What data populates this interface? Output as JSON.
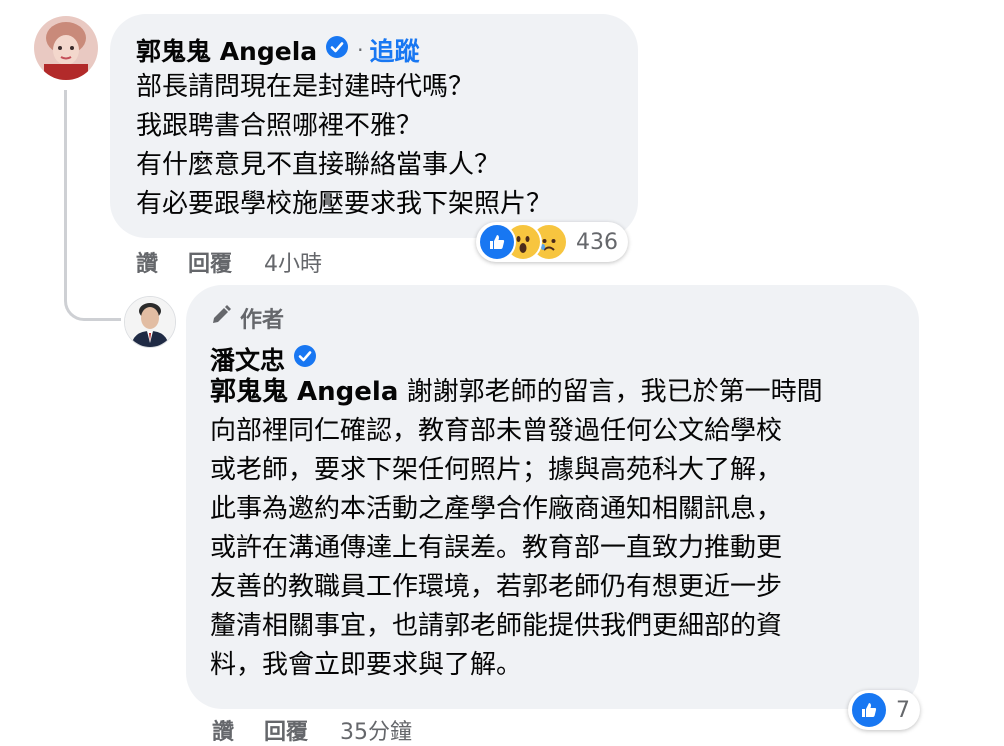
{
  "comment": {
    "author": "郭鬼鬼 Angela",
    "follow_label": "追蹤",
    "follow_separator": "·",
    "lines": [
      "部長請問現在是封建時代嗎？",
      "我跟聘書合照哪裡不雅？",
      "有什麼意見不直接聯絡當事人？",
      "有必要跟學校施壓要求我下架照片？"
    ],
    "reactions": {
      "count": "436",
      "icons": [
        "like-icon",
        "wow-icon",
        "sad-icon"
      ]
    },
    "actions": {
      "like": "讚",
      "reply": "回覆",
      "time": "4小時"
    }
  },
  "reply": {
    "author_tag": "作者",
    "author": "潘文忠",
    "mention": "郭鬼鬼 Angela",
    "lines": [
      " 謝謝郭老師的留言，我已於第一時間",
      "向部裡同仁確認，教育部未曾發過任何公文給學校",
      "或老師，要求下架任何照片；據與高苑科大了解，",
      "此事為邀約本活動之產學合作廠商通知相關訊息，",
      "或許在溝通傳達上有誤差。教育部一直致力推動更",
      "友善的教職員工作環境，若郭老師仍有想更近一步",
      "釐清相關事宜，也請郭老師能提供我們更細部的資",
      "料，我會立即要求與了解。"
    ],
    "reactions": {
      "count": "7",
      "icons": [
        "like-icon"
      ]
    },
    "actions": {
      "like": "讚",
      "reply": "回覆",
      "time": "35分鐘"
    }
  },
  "colors": {
    "bubble": "#f0f2f5",
    "link": "#1877f2",
    "secondary": "#65676b",
    "verified": "#1877f2"
  }
}
